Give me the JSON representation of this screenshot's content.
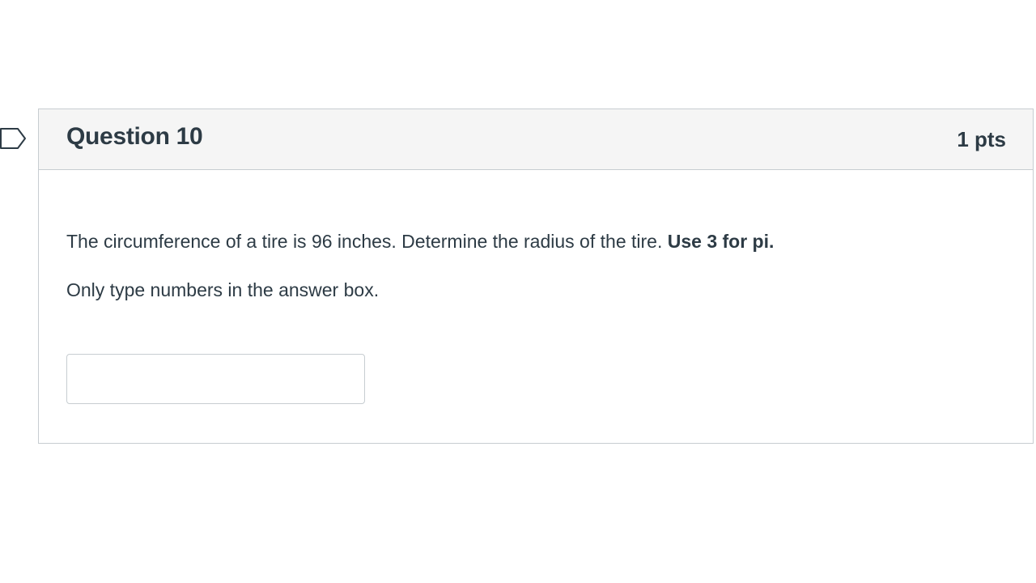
{
  "question": {
    "title": "Question 10",
    "points": "1 pts",
    "text_main": "The circumference of a tire is 96 inches. Determine the radius of the tire. ",
    "text_bold": "Use 3 for pi.",
    "instruction": "Only type numbers in the answer box.",
    "answer_value": "",
    "answer_placeholder": ""
  },
  "icons": {
    "flag": "flag-question-icon"
  },
  "colors": {
    "text": "#2d3b45",
    "header_bg": "#f5f5f5",
    "border": "#c7cdd1"
  }
}
